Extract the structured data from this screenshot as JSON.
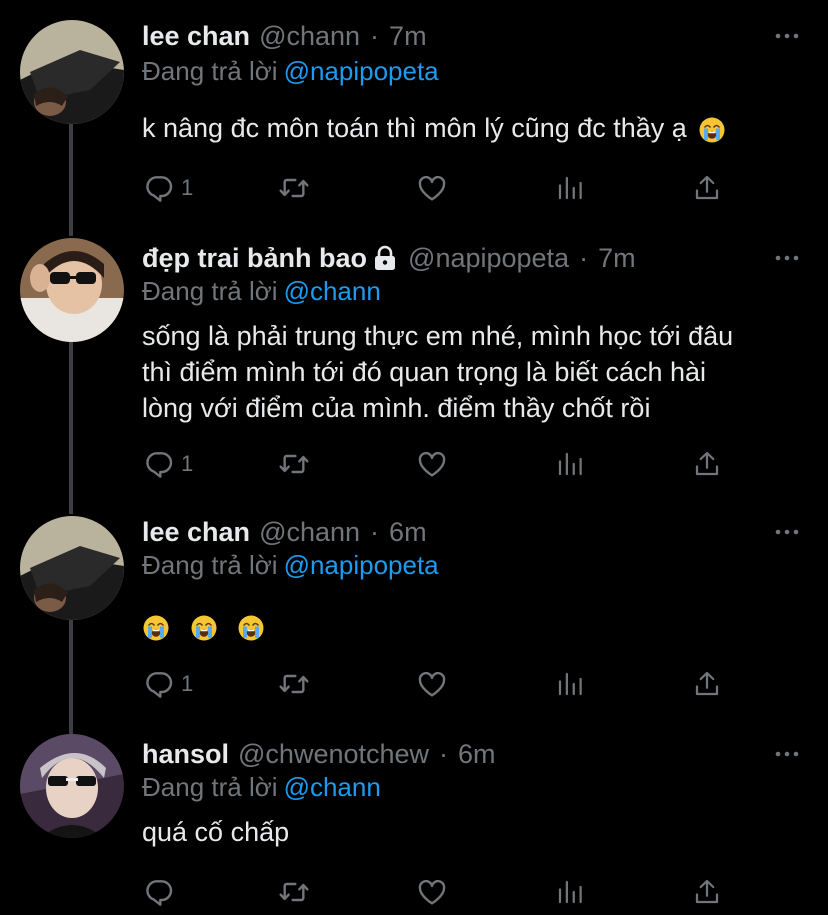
{
  "tweets": [
    {
      "name": "lee chan",
      "handle": "@chann",
      "time": "7m",
      "reply_prefix": "Đang trả lời",
      "reply_to": "@napipopeta",
      "text": "k nâng đc môn toán thì môn lý cũng đc thầy ạ",
      "reply_count": "1",
      "emoji": "loudly-crying-face"
    },
    {
      "name": "đẹp trai bảnh bao",
      "handle": "@napipopeta",
      "time": "7m",
      "reply_prefix": "Đang trả lời",
      "reply_to": "@chann",
      "text_lines": [
        "sống là phải trung thực em nhé, mình học tới đâu",
        "thì điểm mình tới đó quan trọng là biết cách hài",
        "lòng với điểm của mình. điểm thầy chốt rồi"
      ],
      "reply_count": "1",
      "protected_icon": "lock-icon"
    },
    {
      "name": "lee chan",
      "handle": "@chann",
      "time": "6m",
      "reply_prefix": "Đang trả lời",
      "reply_to": "@napipopeta",
      "reply_count": "1",
      "emoji": "loudly-crying-face x3"
    },
    {
      "name": "hansol",
      "handle": "@chwenotchew",
      "time": "6m",
      "reply_prefix": "Đang trả lời",
      "reply_to": "@chann",
      "text": "quá cố chấp",
      "reply_count": ""
    }
  ],
  "separator": "·",
  "colors": {
    "background": "#000000",
    "text": "#e7e9ea",
    "secondary": "#71767b",
    "mention": "#1d9bf0",
    "thread_line": "#3b3f44"
  }
}
